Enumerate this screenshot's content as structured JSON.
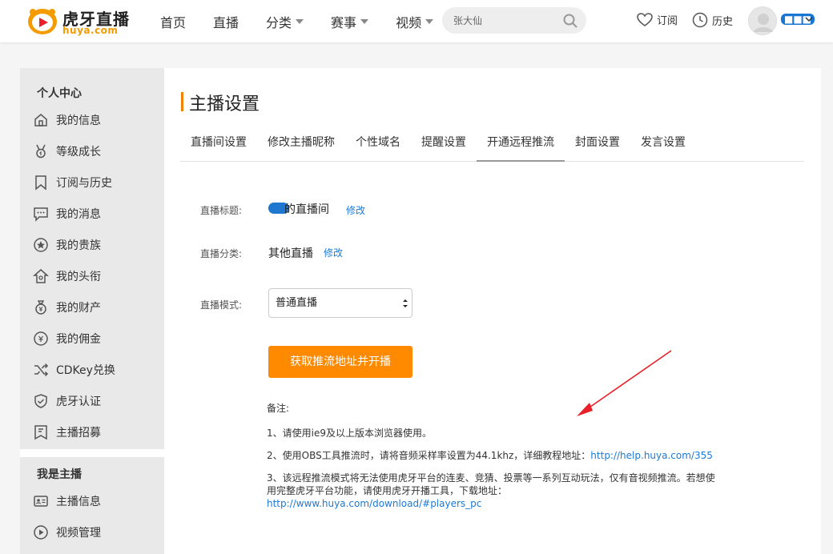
{
  "header": {
    "logo_text": "虎牙直播",
    "logo_sub": "huya.com",
    "nav": [
      {
        "label": "首页",
        "dropdown": false
      },
      {
        "label": "直播",
        "dropdown": false
      },
      {
        "label": "分类",
        "dropdown": true
      },
      {
        "label": "赛事",
        "dropdown": true
      },
      {
        "label": "视频",
        "dropdown": true
      }
    ],
    "search_placeholder": "张大仙",
    "subscribe_label": "订阅",
    "history_label": "历史",
    "user_name": "■■■"
  },
  "sidebar": {
    "group1_title": "个人中心",
    "group1_items": [
      {
        "label": "我的信息",
        "icon": "home-icon"
      },
      {
        "label": "等级成长",
        "icon": "medal-icon"
      },
      {
        "label": "订阅与历史",
        "icon": "bookmark-icon"
      },
      {
        "label": "我的消息",
        "icon": "message-icon"
      },
      {
        "label": "我的贵族",
        "icon": "star-icon"
      },
      {
        "label": "我的头衔",
        "icon": "title-icon"
      },
      {
        "label": "我的财产",
        "icon": "money-bag-icon"
      },
      {
        "label": "我的佣金",
        "icon": "commission-icon"
      },
      {
        "label": "CDKey兑换",
        "icon": "shuffle-icon"
      },
      {
        "label": "虎牙认证",
        "icon": "shield-check-icon"
      },
      {
        "label": "主播招募",
        "icon": "recruit-icon"
      }
    ],
    "group2_title": "我是主播",
    "group2_items": [
      {
        "label": "主播信息",
        "icon": "id-card-icon"
      },
      {
        "label": "视频管理",
        "icon": "play-icon"
      }
    ]
  },
  "main": {
    "title": "主播设置",
    "tabs": [
      "直播间设置",
      "修改主播昵称",
      "个性域名",
      "提醒设置",
      "开通远程推流",
      "封面设置",
      "发言设置"
    ],
    "active_tab": 4,
    "fields": {
      "title_label": "直播标题:",
      "title_value": "的直播间",
      "title_edit": "修改",
      "category_label": "直播分类:",
      "category_value": "其他直播",
      "category_edit": "修改",
      "mode_label": "直播模式:",
      "mode_value": "普通直播"
    },
    "start_button": "获取推流地址并开播",
    "notes_title": "备注:",
    "note1": "1、请使用ie9及以上版本浏览器使用。",
    "note2_text": "2、使用OBS工具推流时，请将音频采样率设置为44.1khz，详细教程地址：",
    "note2_link": "http://help.huya.com/355",
    "note3_text": "3、该远程推流模式将无法使用虎牙平台的连麦、竞猜、投票等一系列互动玩法，仅有音视频推流。若想使用完整虎牙平台功能，请使用虎牙开播工具，下载地址：",
    "note3_link": "http://www.huya.com/download/#players_pc"
  },
  "colors": {
    "accent": "#ff8a00",
    "link": "#1a7ad8",
    "annotation_arrow": "#e8202a"
  }
}
